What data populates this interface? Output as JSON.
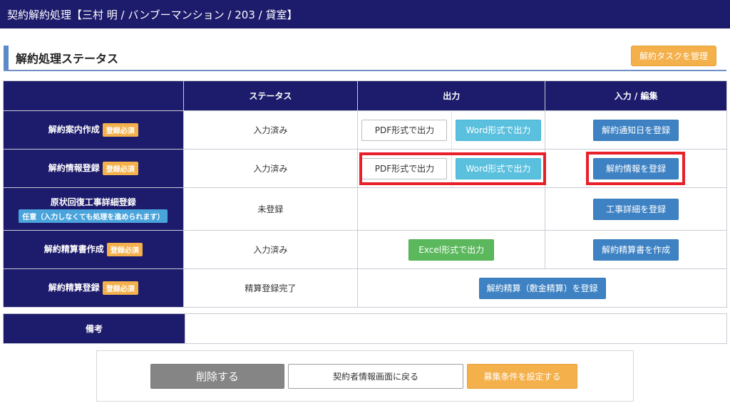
{
  "window": {
    "title": "契約解約処理【三村 明 / バンブーマンション / 203 / 貸室】"
  },
  "section": {
    "title": "解約処理ステータス",
    "manage_button": "解約タスクを管理"
  },
  "table": {
    "headers": [
      "",
      "ステータス",
      "出力",
      "入力 / 編集"
    ],
    "badges": {
      "required": "登録必須",
      "optional": "任意（入力しなくても処理を進められます）"
    },
    "rows": [
      {
        "label": "解約案内作成",
        "status": "入力済み",
        "pdf": "PDF形式で出力",
        "word": "Word形式で出力",
        "action": "解約通知日を登録"
      },
      {
        "label": "解約情報登録",
        "status": "入力済み",
        "pdf": "PDF形式で出力",
        "word": "Word形式で出力",
        "action": "解約情報を登録"
      },
      {
        "label": "原状回復工事詳細登録",
        "status": "未登録",
        "action": "工事詳細を登録"
      },
      {
        "label": "解約精算書作成",
        "status": "入力済み",
        "excel": "Excel形式で出力",
        "action": "解約精算書を作成"
      },
      {
        "label": "解約精算登録",
        "status": "精算登録完了",
        "settle": "解約精算（敷金精算）を登録"
      }
    ]
  },
  "notes": {
    "label": "備考",
    "value": ""
  },
  "footer": {
    "delete_label": "削除する",
    "back_label": "契約者情報画面に戻る",
    "recruit_label": "募集条件を設定する"
  },
  "colors": {
    "navy": "#1d1b6b",
    "orange": "#f4b04b",
    "cyan": "#5bc0de",
    "blue": "#3e82c4",
    "green": "#5cb85c",
    "highlight": "#e8202a"
  }
}
